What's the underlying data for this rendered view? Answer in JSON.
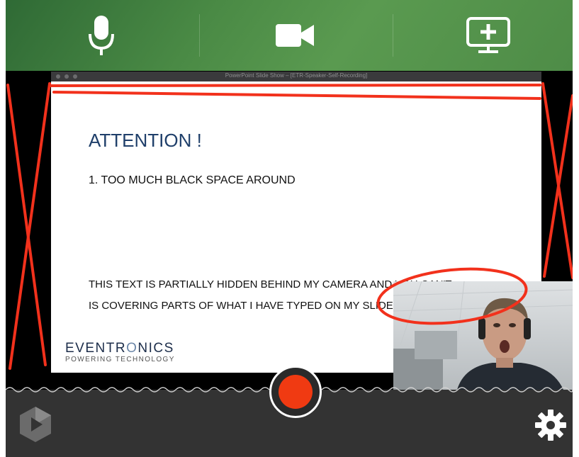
{
  "window": {
    "title": "PowerPoint Slide Show – [ETR-Speaker-Self-Recording]"
  },
  "toolbar": {
    "buttons": [
      {
        "name": "microphone-button",
        "icon": "microphone-icon"
      },
      {
        "name": "camera-button",
        "icon": "video-camera-icon"
      },
      {
        "name": "screen-share-button",
        "icon": "screen-add-icon"
      }
    ]
  },
  "slide": {
    "title": "ATTENTION !",
    "list_item": "1.  TOO MUCH BLACK SPACE AROUND",
    "body_line1": "THIS TEXT IS PARTIALLY HIDDEN BEHIND MY CAMERA AND YOU CAN'T",
    "body_line2": "IS COVERING PARTS OF WHAT I HAVE TYPED ON MY SLIDE"
  },
  "logo": {
    "main_prefix": "EVENTR",
    "main_mid": "O",
    "main_suffix": "NICS",
    "tagline": "POWERING TECHNOLOGY"
  },
  "bottom": {
    "record_icon": "record-icon",
    "app_icon": "app-logo-icon",
    "settings_icon": "gear-icon"
  },
  "colors": {
    "toolbar_green": "#4a8a45",
    "record_red": "#f03a12",
    "annotation_red": "#f2311c",
    "slide_title_blue": "#1f3f6a",
    "bottom_bar": "#333333"
  }
}
